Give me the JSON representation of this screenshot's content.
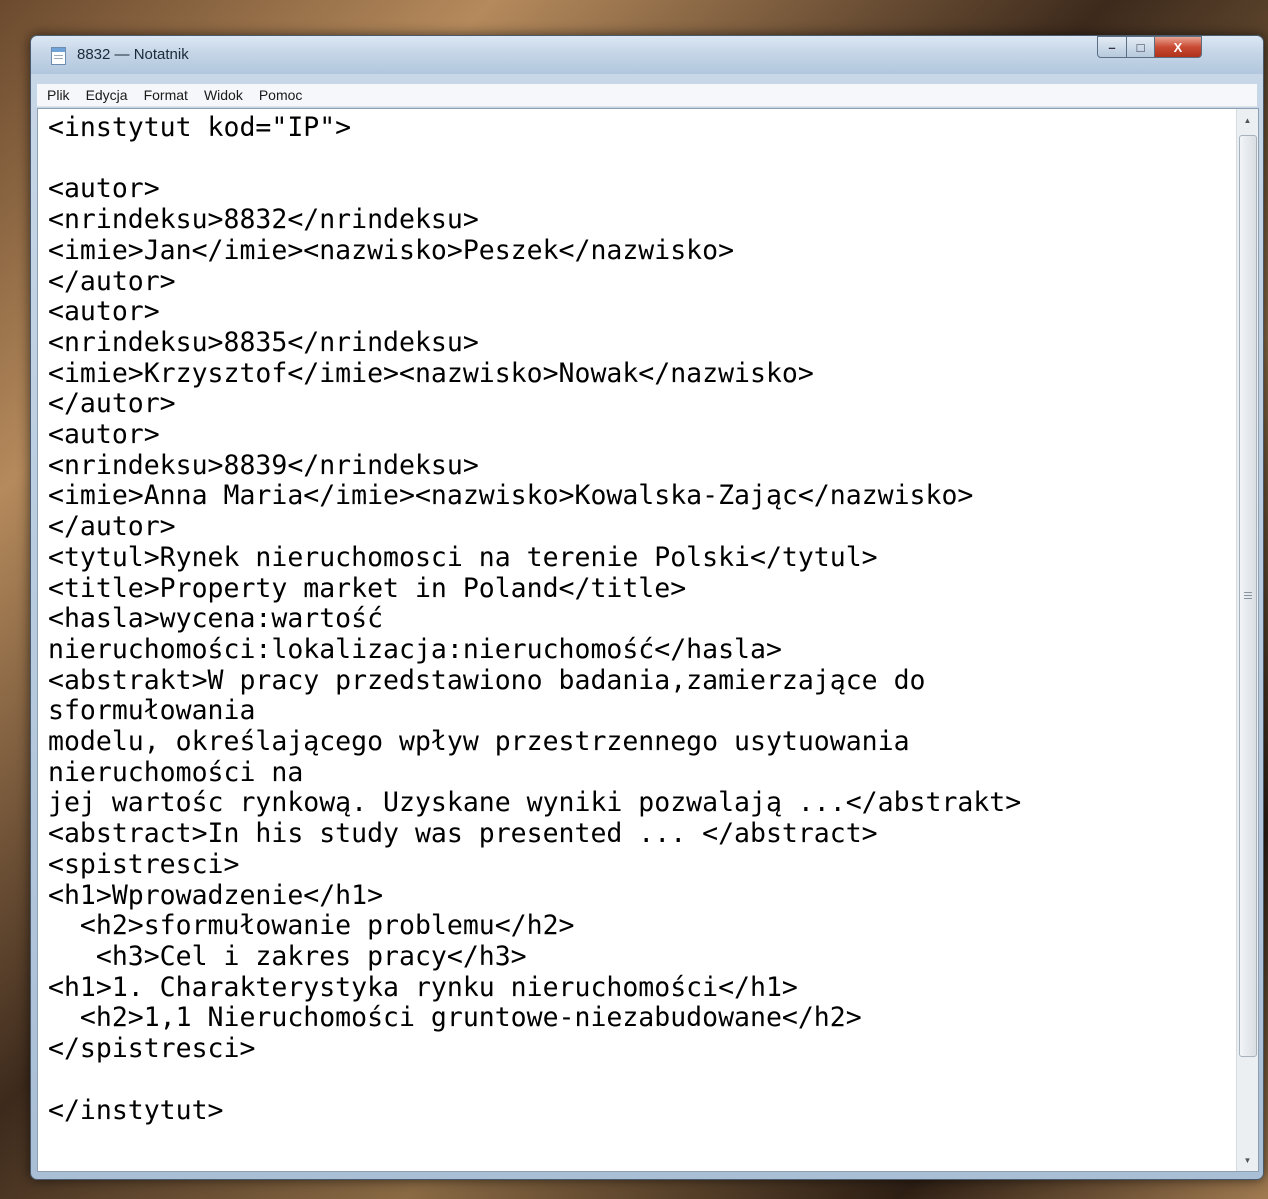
{
  "window": {
    "title": "8832 — Notatnik",
    "controls": {
      "minimize": "–",
      "maximize": "□",
      "close": "X"
    }
  },
  "menu": [
    "Plik",
    "Edycja",
    "Format",
    "Widok",
    "Pomoc"
  ],
  "editor": {
    "lines": [
      "<instytut kod=\"IP\">",
      "",
      "<autor>",
      "<nrindeksu>8832</nrindeksu>",
      "<imie>Jan</imie><nazwisko>Peszek</nazwisko>",
      "</autor>",
      "<autor>",
      "<nrindeksu>8835</nrindeksu>",
      "<imie>Krzysztof</imie><nazwisko>Nowak</nazwisko>",
      "</autor>",
      "<autor>",
      "<nrindeksu>8839</nrindeksu>",
      "<imie>Anna Maria</imie><nazwisko>Kowalska-Zając</nazwisko>",
      "</autor>",
      "<tytul>Rynek nieruchomosci na terenie Polski</tytul>",
      "<title>Property market in Poland</title>",
      "<hasla>wycena:wartość",
      "nieruchomości:lokalizacja:nieruchomość</hasla>",
      "<abstrakt>W pracy przedstawiono badania,zamierzające do",
      "sformułowania",
      "modelu, określającego wpływ przestrzennego usytuowania",
      "nieruchomości na",
      "jej wartośc rynkową. Uzyskane wyniki pozwalają ...</abstrakt>",
      "<abstract>In his study was presented ... </abstract>",
      "<spistresci>",
      "<h1>Wprowadzenie</h1>",
      "  <h2>sformułowanie problemu</h2>",
      "   <h3>Cel i zakres pracy</h3>",
      "<h1>1. Charakterystyka rynku nieruchomości</h1>",
      "  <h2>1,1 Nieruchomości gruntowe-niezabudowane</h2>",
      "</spistresci>",
      "",
      "</instytut>"
    ]
  }
}
